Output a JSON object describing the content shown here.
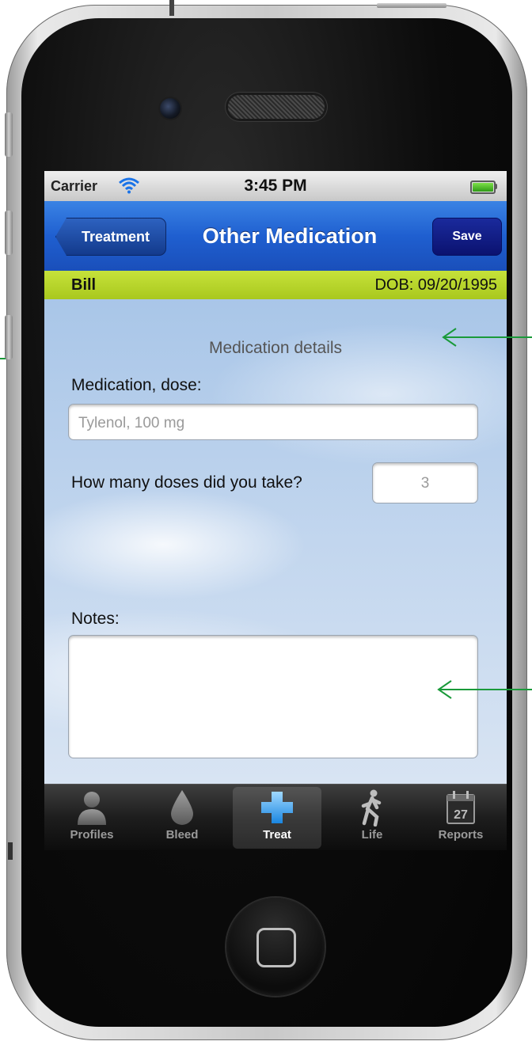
{
  "status_bar": {
    "carrier": "Carrier",
    "time": "3:45 PM"
  },
  "nav": {
    "back_label": "Treatment",
    "title": "Other Medication",
    "save_label": "Save"
  },
  "patient": {
    "name": "Bill",
    "dob": "DOB: 09/20/1995"
  },
  "form": {
    "section_title": "Medication details",
    "medication_label": "Medication, dose:",
    "medication_placeholder": "Tylenol, 100 mg",
    "doses_label": "How many doses did you take?",
    "doses_value": "3",
    "notes_label": "Notes:",
    "notes_value": ""
  },
  "tabs": [
    {
      "label": "Profiles",
      "icon": "person-icon",
      "active": false
    },
    {
      "label": "Bleed",
      "icon": "drop-icon",
      "active": false
    },
    {
      "label": "Treat",
      "icon": "cross-icon",
      "active": true
    },
    {
      "label": "Life",
      "icon": "walking-icon",
      "active": false
    },
    {
      "label": "Reports",
      "icon": "calendar-icon",
      "active": false,
      "badge": "27"
    }
  ],
  "colors": {
    "nav_blue": "#1f5fd0",
    "patient_bar_green": "#b5d22a",
    "annotation_arrow": "#1a9a3a",
    "save_button": "#0b1270"
  }
}
